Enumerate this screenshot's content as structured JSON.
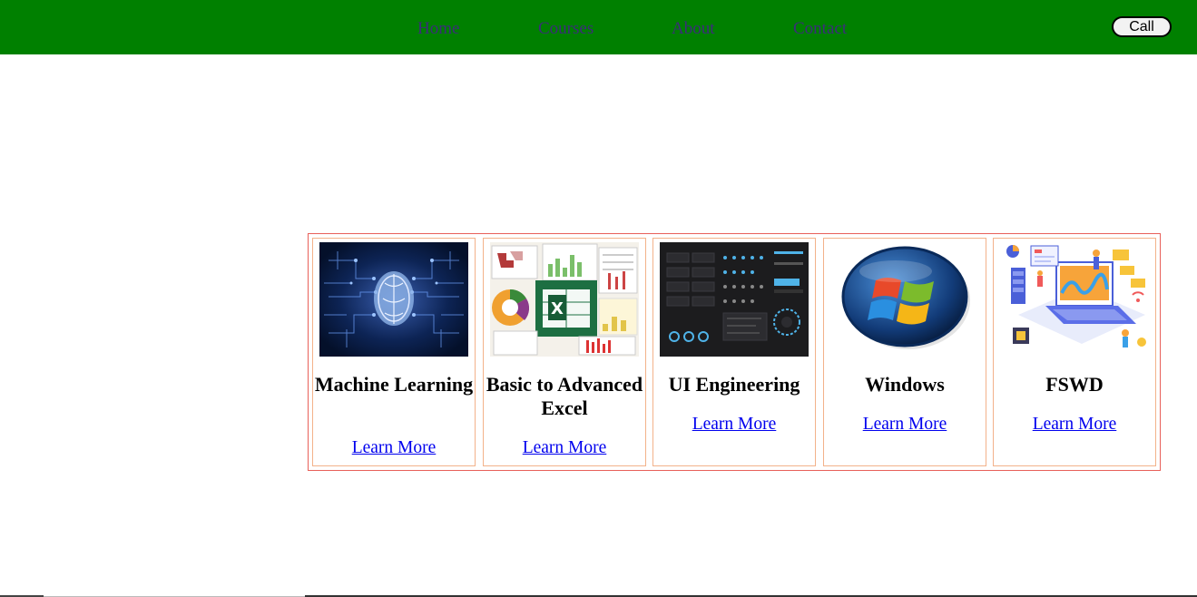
{
  "nav": {
    "home": "Home",
    "courses": "Courses",
    "about": "About",
    "contact": "Contact",
    "call": "Call"
  },
  "colors": {
    "navbar": "#008000",
    "nav_link": "#3b2d7a",
    "link": "#0000ee",
    "outer_border": "#e8605a",
    "card_border": "#f3b28a"
  },
  "courses": [
    {
      "title": "Machine Learning",
      "link": "Learn More",
      "image": "brain-circuit-image"
    },
    {
      "title": "Basic to Advanced Excel",
      "link": "Learn More",
      "image": "excel-logo-image"
    },
    {
      "title": "UI Engineering",
      "link": "Learn More",
      "image": "ui-kit-image"
    },
    {
      "title": "Windows",
      "link": "Learn More",
      "image": "windows-logo-image"
    },
    {
      "title": "FSWD",
      "link": "Learn More",
      "image": "fullstack-illustration-image"
    }
  ]
}
